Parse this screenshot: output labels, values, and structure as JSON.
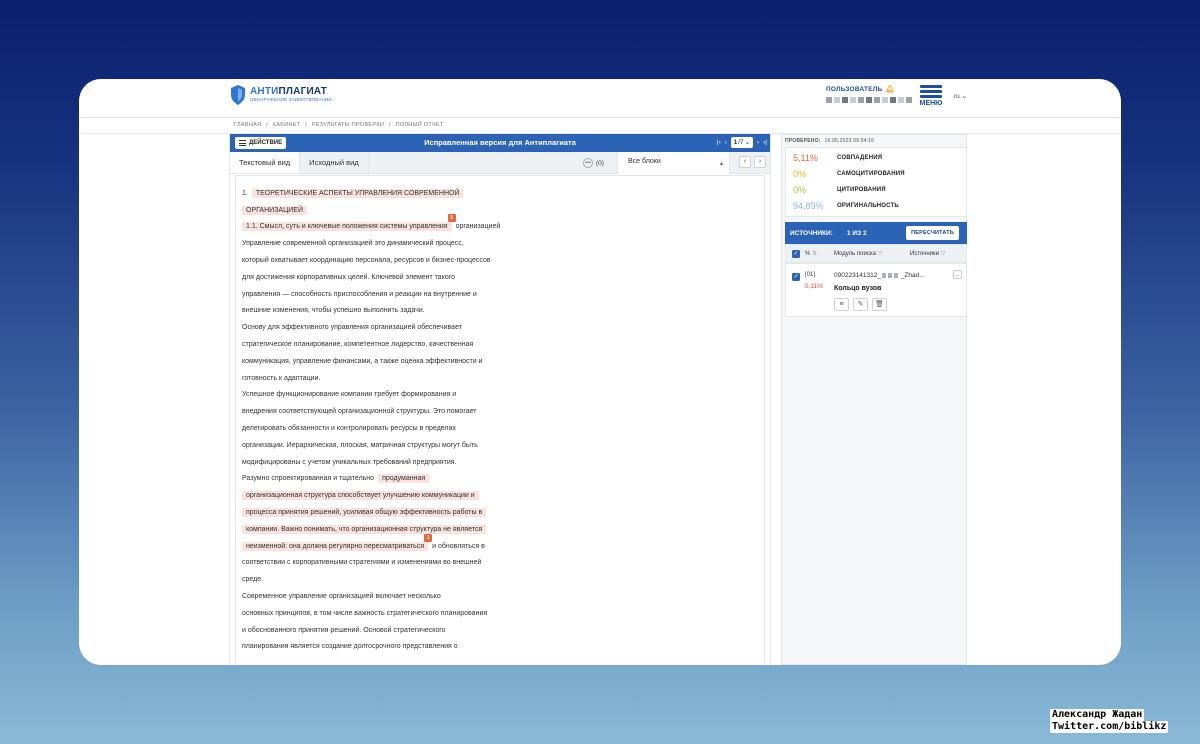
{
  "header": {
    "logo_main_a": "АНТИ",
    "logo_main_b": "ПЛАГИАТ",
    "logo_sub": "ОБНАРУЖЕНИЕ ЗАИМСТВОВАНИЙ",
    "user_label": "ПОЛЬЗОВАТЕЛЬ",
    "menu_label": "МЕНЮ",
    "lang": "ru"
  },
  "breadcrumbs": [
    "ГЛАВНАЯ",
    "/",
    "КАБИНЕТ",
    "/",
    "РЕЗУЛЬТАТЫ ПРОВЕРКИ",
    "/",
    "ПОЛНЫЙ ОТЧЕТ"
  ],
  "toolbar": {
    "action_label": "ДЕЙСТВИЕ",
    "title": "Исправленная версия для Антиплагиата",
    "page_current": "1",
    "page_total": "/7"
  },
  "tabs": {
    "text_view": "Текстовый вид",
    "source_view": "Исходный вид",
    "comments_count": "(0)",
    "blocks": "Все блоки"
  },
  "document": {
    "lines": [
      {
        "pre": "1.",
        "hl": "ТЕОРЕТИЧЕСКИЕ АСПЕКТЫ УПРАВЛЕНИЯ СОВРЕМЕННОЙ",
        "post": ""
      },
      {
        "pre": "",
        "hl": "ОРГАНИЗАЦИЕЙ",
        "post": ""
      },
      {
        "pre": "",
        "hl": "1.1. Смысл, суть и ключевые положения системы управления",
        "post": "организацией",
        "mark": "1"
      },
      {
        "pre": "Управление современной организацией это динамический процесс,",
        "hl": "",
        "post": ""
      },
      {
        "pre": "который охватывает координацию персонала, ресурсов и бизнес-процессов",
        "hl": "",
        "post": ""
      },
      {
        "pre": "для достижения корпоративных целей. Ключевой элемент такого",
        "hl": "",
        "post": ""
      },
      {
        "pre": "управления — способность приспособления и реакции на внутренние и",
        "hl": "",
        "post": ""
      },
      {
        "pre": "внешние изменения, чтобы успешно выполнить задачи.",
        "hl": "",
        "post": ""
      },
      {
        "pre": "Основу для эффективного управления организацией обеспечивает",
        "hl": "",
        "post": ""
      },
      {
        "pre": "стратегическое планирование, компетентное лидерство, качественная",
        "hl": "",
        "post": ""
      },
      {
        "pre": "коммуникация, управление финансами, а также оценка эффективности и",
        "hl": "",
        "post": ""
      },
      {
        "pre": "готовность к адаптации.",
        "hl": "",
        "post": ""
      },
      {
        "pre": "Успешное функционирование компании требует формирования и",
        "hl": "",
        "post": ""
      },
      {
        "pre": "внедрения соответствующей организационной структуры. Это помогает",
        "hl": "",
        "post": ""
      },
      {
        "pre": "делегировать обязанности и контролировать ресурсы в пределах",
        "hl": "",
        "post": ""
      },
      {
        "pre": "организации. Иерархическая, плоская, матричная структуры могут быть",
        "hl": "",
        "post": ""
      },
      {
        "pre": "модифицированы с учетом уникальных требований предприятия.",
        "hl": "",
        "post": ""
      },
      {
        "pre": "Разумно спроектированная и тщательно",
        "hl": "продуманная",
        "post": ""
      },
      {
        "pre": "",
        "hl": "организационная структура способствует улучшению коммуникации и",
        "post": ""
      },
      {
        "pre": "",
        "hl": "процесса принятия решений, усиливая общую эффективность работы в",
        "post": ""
      },
      {
        "pre": "",
        "hl": "компании. Важно понимать, что организационная структура не является",
        "post": ""
      },
      {
        "pre": "",
        "hl": "неизменной: она должна регулярно пересматриваться",
        "post": "и обновляться в",
        "mark": "1"
      },
      {
        "pre": "соответствии с корпоративными стратегиями и изменениями во внешней",
        "hl": "",
        "post": ""
      },
      {
        "pre": "среде.",
        "hl": "",
        "post": ""
      },
      {
        "pre": "Современное управление организацией включает несколько",
        "hl": "",
        "post": ""
      },
      {
        "pre": "основных принципов, в том числе важность стратегического планирования",
        "hl": "",
        "post": ""
      },
      {
        "pre": "и обоснованного принятия решений. Основой стратегического",
        "hl": "",
        "post": ""
      },
      {
        "pre": "планирования является создание долгосрочного представления о",
        "hl": "",
        "post": ""
      }
    ]
  },
  "report": {
    "checked_label": "ПРОВЕРЕНО:",
    "checked_date": "16.05.2023 09:54:16",
    "stats": [
      {
        "value": "5,11%",
        "label": "СОВПАДЕНИЯ",
        "color": "#e8663c"
      },
      {
        "value": "0%",
        "label": "САМОЦИТИРОВАНИЯ",
        "color": "#f0b41e"
      },
      {
        "value": "0%",
        "label": "ЦИТИРОВАНИЯ",
        "color": "#a8c43a"
      },
      {
        "value": "94,89%",
        "label": "ОРИГИНАЛЬНОСТЬ",
        "color": "#9ab5d6"
      }
    ],
    "sources_label": "ИСТОЧНИКИ:",
    "sources_count": "1 ИЗ 2",
    "recalc_label": "ПЕРЕСЧИТАТЬ",
    "col_percent": "%",
    "col_module": "Модуль поиска",
    "col_sources": "Источники",
    "source_row": {
      "id": "[01]",
      "percent": "5,11%",
      "source_prefix": "090223141312_",
      "source_suffix": "_Zhad...",
      "module_name": "Кольцо вузов"
    }
  },
  "credit": {
    "line1": "Александр Жадан",
    "line2": "Twitter.com/biblikz"
  }
}
